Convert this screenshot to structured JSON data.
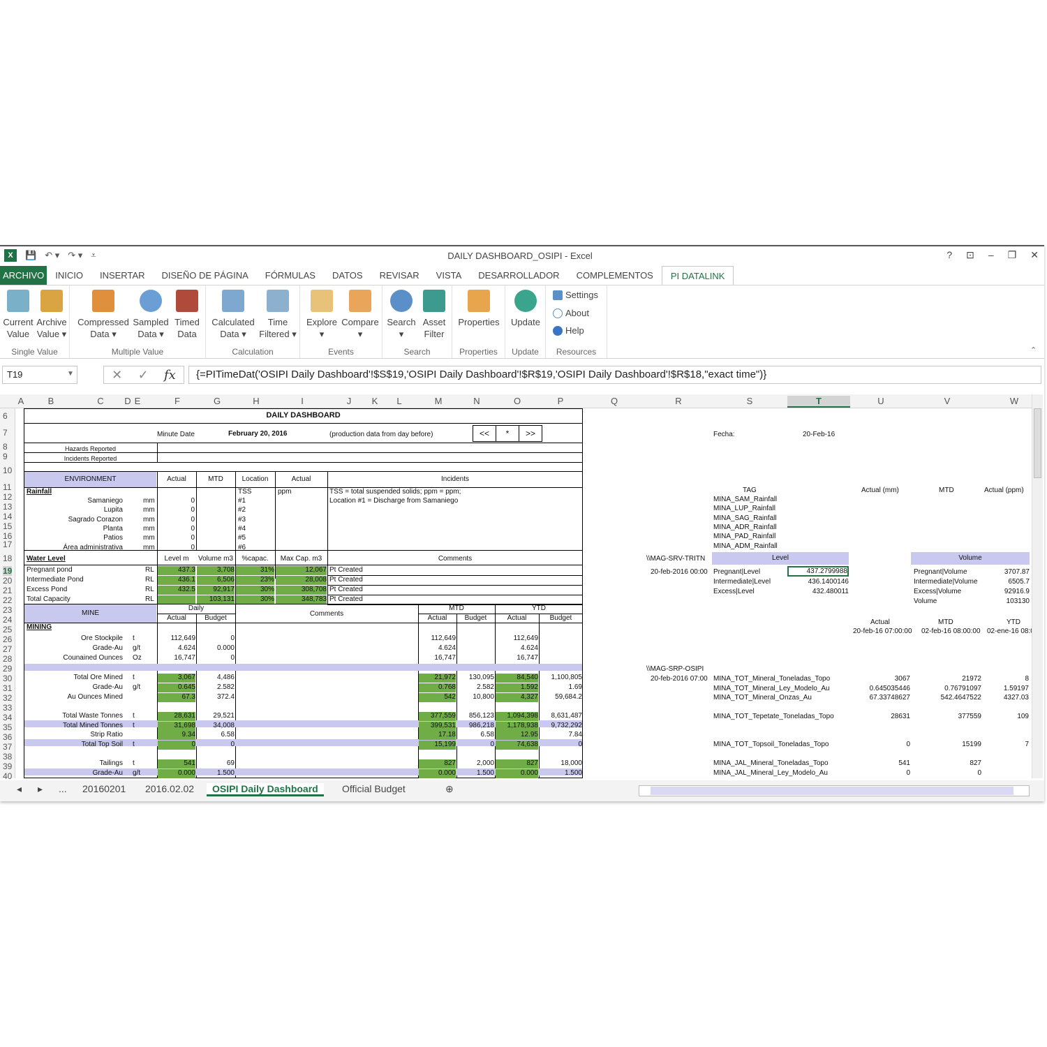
{
  "window": {
    "title": "DAILY DASHBOARD_OSIPI - Excel",
    "help": "?",
    "minimize": "–",
    "restore": "❐",
    "close": "✕"
  },
  "tabs": [
    "ARCHIVO",
    "INICIO",
    "INSERTAR",
    "DISEÑO DE PÁGINA",
    "FÓRMULAS",
    "DATOS",
    "REVISAR",
    "VISTA",
    "DESARROLLADOR",
    "COMPLEMENTOS",
    "PI DATALINK"
  ],
  "ribbon": {
    "current_value": [
      "Current",
      "Value"
    ],
    "archive_value": [
      "Archive",
      "Value ▾"
    ],
    "compressed": [
      "Compressed",
      "Data ▾"
    ],
    "sampled": [
      "Sampled",
      "Data ▾"
    ],
    "timed": [
      "Timed",
      "Data"
    ],
    "calculated": [
      "Calculated",
      "Data ▾"
    ],
    "time_filtered": [
      "Time",
      "Filtered ▾"
    ],
    "explore": [
      "Explore",
      "▾"
    ],
    "compare": [
      "Compare",
      "▾"
    ],
    "search": [
      "Search",
      "▾"
    ],
    "asset_filter": [
      "Asset",
      "Filter"
    ],
    "properties": [
      "Properties"
    ],
    "update": [
      "Update"
    ],
    "settings": "Settings",
    "about": "About",
    "help": "Help",
    "groups": [
      "Single Value",
      "Multiple Value",
      "Calculation",
      "Events",
      "Search",
      "Properties",
      "Update",
      "Resources"
    ]
  },
  "namebox": "T19",
  "formula": "{=PITimeDat('OSIPI Daily Dashboard'!$S$19,'OSIPI Daily Dashboard'!$R$19,'OSIPI Daily Dashboard'!$R$18,\"exact time\")}",
  "columns": [
    "A",
    "B",
    "C",
    "D",
    "E",
    "F",
    "G",
    "H",
    "I",
    "J",
    "K",
    "L",
    "M",
    "N",
    "O",
    "P",
    "Q",
    "R",
    "S",
    "T",
    "U",
    "V",
    "W"
  ],
  "rows": [
    "6",
    "7",
    "8",
    "9",
    "10",
    "11",
    "12",
    "13",
    "14",
    "15",
    "16",
    "17",
    "18",
    "19",
    "20",
    "21",
    "22",
    "23",
    "24",
    "25",
    "26",
    "27",
    "28",
    "29",
    "30",
    "31",
    "32",
    "33",
    "34",
    "35",
    "36",
    "37",
    "38",
    "39",
    "40"
  ],
  "dash": {
    "title": "DAILY DASHBOARD",
    "minute_date": "Minute Date",
    "date": "February 20, 2016",
    "note": "(production data from day before)",
    "nav_prev": "<<",
    "nav_now": "*",
    "nav_next": ">>",
    "hazards": "Hazards Reported",
    "incidents": "Incidents Reported",
    "env": "ENVIRONMENT",
    "actual": "Actual",
    "mtd": "MTD",
    "location": "Location",
    "incidents_hdr": "Incidents",
    "rainfall": "Rainfall",
    "tss": "TSS",
    "ppm": "ppm",
    "tss_note": "TSS = total suspended solids; ppm = ppm;",
    "loc_note": "Location #1 = Discharge from Samaniego",
    "rain_rows": [
      [
        "Samaniego",
        "mm",
        "0",
        "#1"
      ],
      [
        "Lupita",
        "mm",
        "0",
        "#2"
      ],
      [
        "Sagrado Corazon",
        "mm",
        "0",
        "#3"
      ],
      [
        "Planta",
        "mm",
        "0",
        "#4"
      ],
      [
        "Patios",
        "mm",
        "0",
        "#5"
      ],
      [
        "Área administrativa",
        "mm",
        "0",
        "#6"
      ]
    ],
    "water_level": "Water Level",
    "level_m": "Level m",
    "volume_m3": "Volume m3",
    "capac": "%capac.",
    "max_cap": "Max Cap. m3",
    "comments": "Comments",
    "water_rows": [
      [
        "Pregnant pond",
        "RL",
        "437.3",
        "3,708",
        "31%",
        "12,067",
        "Pt Created"
      ],
      [
        "Intermediate Pond",
        "RL",
        "436.1",
        "6,506",
        "23%",
        "28,008",
        "Pt Created"
      ],
      [
        "Excess Pond",
        "RL",
        "432.5",
        "92,917",
        "30%",
        "308,708",
        "Pt Created"
      ],
      [
        "Total Capacity",
        "RL",
        "",
        "103,131",
        "30%",
        "348,783",
        "Pt Created"
      ]
    ],
    "mine": "MINE",
    "daily": "Daily",
    "mtd_hdr": "MTD",
    "ytd_hdr": "YTD",
    "budget": "Budget",
    "mining": "MINING",
    "mine_rows": [
      [
        "Ore Stockpile",
        "t",
        "112,649",
        "0",
        "112,649",
        "",
        "112,649",
        ""
      ],
      [
        "Grade-Au",
        "g/t",
        "4.624",
        "0.000",
        "4.624",
        "",
        "4.624",
        ""
      ],
      [
        "Counained Ounces",
        "Oz",
        "16,747",
        "0",
        "16,747",
        "",
        "16,747",
        ""
      ],
      [
        "Total Ore Mined",
        "t",
        "3,067",
        "4,486",
        "21,972",
        "130,095",
        "84,540",
        "1,100,805"
      ],
      [
        "Grade-Au",
        "g/t",
        "0.645",
        "2.582",
        "0.768",
        "2.582",
        "1.592",
        "1.69"
      ],
      [
        "Au Ounces Mined",
        "",
        "67.3",
        "372.4",
        "542",
        "10,800",
        "4,327",
        "59,684.2"
      ],
      [
        "Total Waste Tonnes",
        "t",
        "28,631",
        "29,521",
        "377,559",
        "856,123",
        "1,094,398",
        "8,631,487"
      ],
      [
        "Total Mined Tonnes",
        "t",
        "31,698",
        "34,008",
        "399,531",
        "986,218",
        "1,178,938",
        "9,732,292"
      ],
      [
        "Strip Ratio",
        "",
        "9.34",
        "6.58",
        "17.18",
        "6.58",
        "12.95",
        "7.84"
      ],
      [
        "Total Top Soil",
        "t",
        "0",
        "0",
        "15,199",
        "0",
        "74,638",
        "0"
      ],
      [
        "Tailings",
        "t",
        "541",
        "69",
        "827",
        "2,000",
        "827",
        "18,000"
      ],
      [
        "Grade-Au",
        "g/t",
        "0.000",
        "1.500",
        "0.000",
        "1.500",
        "0.000",
        "1.500"
      ]
    ]
  },
  "right": {
    "fecha": "Fecha:",
    "fecha_val": "20-Feb-16",
    "tag": "TAG",
    "actual_mm": "Actual (mm)",
    "mtd": "MTD",
    "actual_ppm": "Actual (ppm)",
    "tags": [
      "MINA_SAM_Rainfall",
      "MINA_LUP_Rainfall",
      "MINA_SAG_Rainfall",
      "MINA_ADR_Rainfall",
      "MINA_PAD_Rainfall",
      "MINA_ADM_Rainfall"
    ],
    "server1": "\\\\MAG-SRV-TRITN",
    "level": "Level",
    "volume": "Volume",
    "date1": "20-feb-2016 00:00",
    "level_rows": [
      [
        "Pregnant|Level",
        "437.2799988"
      ],
      [
        "Intermediate|Level",
        "436.1400146"
      ],
      [
        "Excess|Level",
        "432.480011"
      ]
    ],
    "vol_rows": [
      [
        "Pregnant|Volume",
        "3707.87"
      ],
      [
        "Intermediate|Volume",
        "6505.7"
      ],
      [
        "Excess|Volume",
        "92916.9"
      ],
      [
        "Volume",
        "103130"
      ]
    ],
    "actual": "Actual",
    "ytd": "YTD",
    "d_actual": "20-feb-16 07:00:00",
    "d_mtd": "02-feb-16 08:00:00",
    "d_ytd": "02-ene-16 08:0",
    "server2": "\\\\MAG-SRP-OSIPI",
    "date2": "20-feb-2016 07:00",
    "mine_tags": [
      [
        "MINA_TOT_Mineral_Toneladas_Topo",
        "3067",
        "21972",
        "8"
      ],
      [
        "MINA_TOT_Mineral_Ley_Modelo_Au",
        "0.645035446",
        "0.76791097",
        "1.59197"
      ],
      [
        "MINA_TOT_Mineral_Onzas_Au",
        "67.33748627",
        "542.4647522",
        "4327.03"
      ],
      [
        "MINA_TOT_Tepetate_Toneladas_Topo",
        "28631",
        "377559",
        "109"
      ],
      [
        "MINA_TOT_Topsoil_Toneladas_Topo",
        "0",
        "15199",
        "7"
      ],
      [
        "MINA_JAL_Mineral_Toneladas_Topo",
        "541",
        "827",
        ""
      ],
      [
        "MINA_JAL_Mineral_Ley_Modelo_Au",
        "0",
        "0",
        ""
      ]
    ]
  },
  "sheets": [
    "...",
    "20160201",
    "2016.02.02",
    "OSIPI Daily Dashboard",
    "Official Budget",
    "⊕"
  ]
}
